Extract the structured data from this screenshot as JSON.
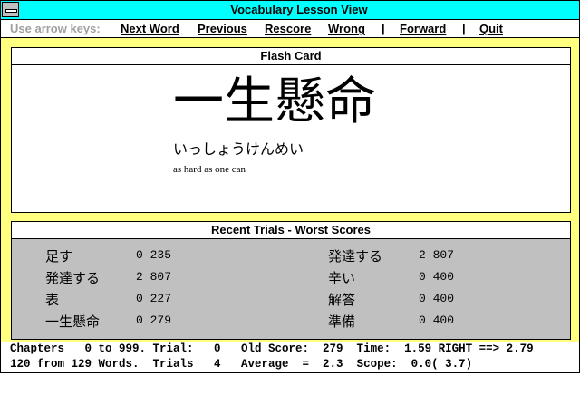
{
  "window": {
    "title": "Vocabulary Lesson View"
  },
  "menu": {
    "hint": "Use arrow keys:",
    "next_word": "Next Word",
    "previous": "Previous",
    "rescore": "Rescore",
    "wrong": "Wrong",
    "forward": "Forward",
    "quit": "Quit",
    "separator": "|"
  },
  "flash_card": {
    "title": "Flash Card",
    "kanji": "一生懸命",
    "reading": "いっしょうけんめい",
    "meaning": "as hard as one can"
  },
  "recent_trials": {
    "title": "Recent Trials - Worst Scores",
    "left": [
      {
        "word": "足す",
        "score": "0 235"
      },
      {
        "word": "発達する",
        "score": "2 807"
      },
      {
        "word": "表",
        "score": "0 227"
      },
      {
        "word": "一生懸命",
        "score": "0 279"
      }
    ],
    "right": [
      {
        "word": "発達する",
        "score": "2 807"
      },
      {
        "word": "辛い",
        "score": "0 400"
      },
      {
        "word": "解答",
        "score": "0 400"
      },
      {
        "word": "準備",
        "score": "0 400"
      }
    ]
  },
  "status": {
    "line1": "Chapters   0 to 999. Trial:   0   Old Score:  279  Time:  1.59 RIGHT ==> 2.79",
    "line2": "120 from 129 Words.  Trials   4   Average  =  2.3  Scope:  0.0( 3.7)"
  }
}
